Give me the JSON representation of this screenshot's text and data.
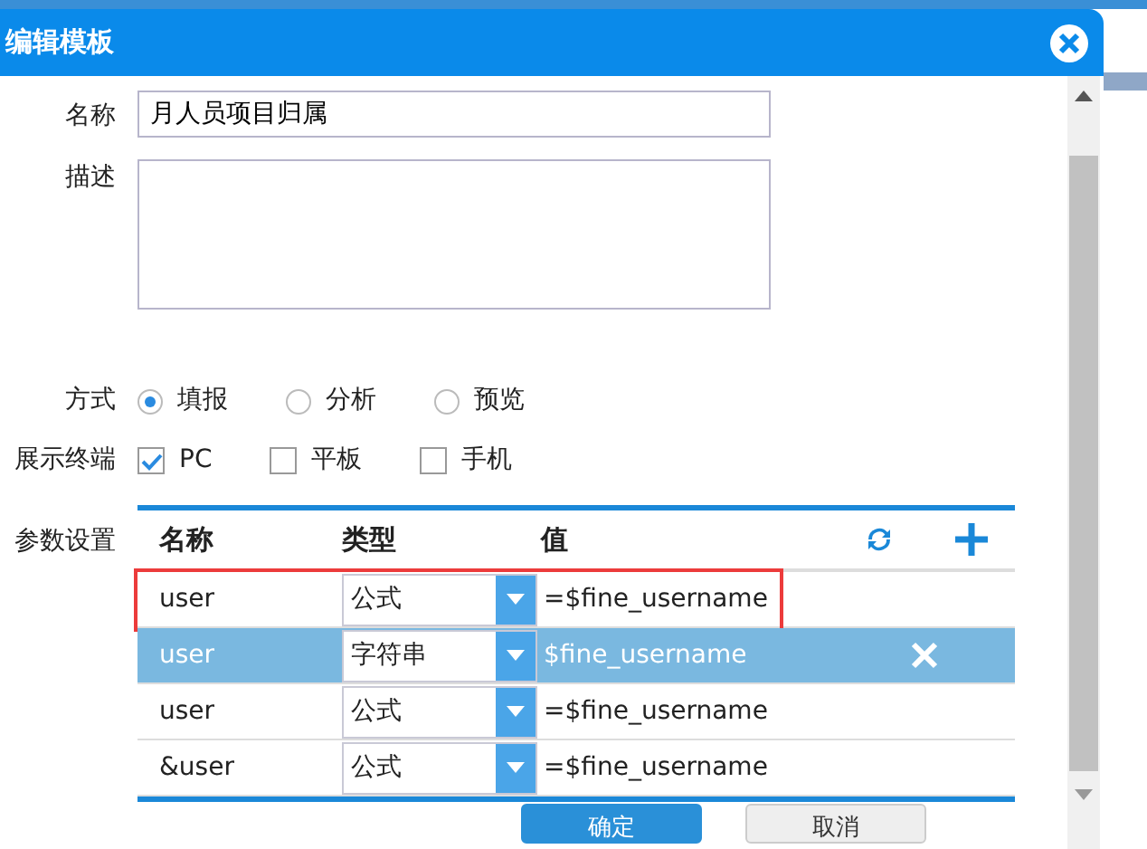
{
  "dialog": {
    "title": "编辑模板"
  },
  "form": {
    "name_label": "名称",
    "name_value": "月人员项目归属",
    "description_label": "描述",
    "mode_label": "方式",
    "modes": [
      {
        "label": "填报",
        "selected": true
      },
      {
        "label": "分析",
        "selected": false
      },
      {
        "label": "预览",
        "selected": false
      }
    ],
    "terminal_label": "展示终端",
    "terminals": [
      {
        "label": "PC",
        "checked": true
      },
      {
        "label": "平板",
        "checked": false
      },
      {
        "label": "手机",
        "checked": false
      }
    ],
    "params_label": "参数设置"
  },
  "params": {
    "columns": [
      "名称",
      "类型",
      "值"
    ],
    "rows": [
      {
        "name": "user",
        "type": "公式",
        "value": "=$fine_username",
        "selected": false,
        "outlined": true
      },
      {
        "name": "user",
        "type": "字符串",
        "value": "$fine_username",
        "selected": true,
        "outlined": false
      },
      {
        "name": "user",
        "type": "公式",
        "value": "=$fine_username",
        "selected": false,
        "outlined": false
      },
      {
        "name": "&user",
        "type": "公式",
        "value": "=$fine_username",
        "selected": false,
        "outlined": false
      }
    ]
  },
  "buttons": [
    {
      "label": "确定",
      "kind": "primary"
    },
    {
      "label": "取消",
      "kind": "secondary"
    }
  ]
}
